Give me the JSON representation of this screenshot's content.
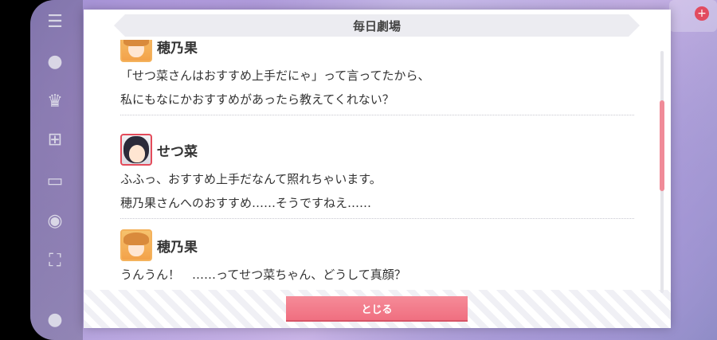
{
  "theater": {
    "title": "毎日劇場",
    "entries": [
      {
        "speaker": "穂乃果",
        "lines": [
          "「せつ菜さんはおすすめ上手だにゃ」って言ってたから、",
          "私にもなにかおすすめがあったら教えてくれない？"
        ]
      },
      {
        "speaker": "せつ菜",
        "lines": [
          "ふふっ、おすすめ上手だなんて照れちゃいます。",
          "穂乃果さんへのおすすめ……そうですねえ……"
        ]
      },
      {
        "speaker": "穂乃果",
        "lines": [
          "うんうん！　……ってせつ菜ちゃん、どうして真顔？"
        ]
      }
    ],
    "close_label": "とじる"
  },
  "colors": {
    "accent": "#f07a8a",
    "title_bg": "#ececf1"
  }
}
